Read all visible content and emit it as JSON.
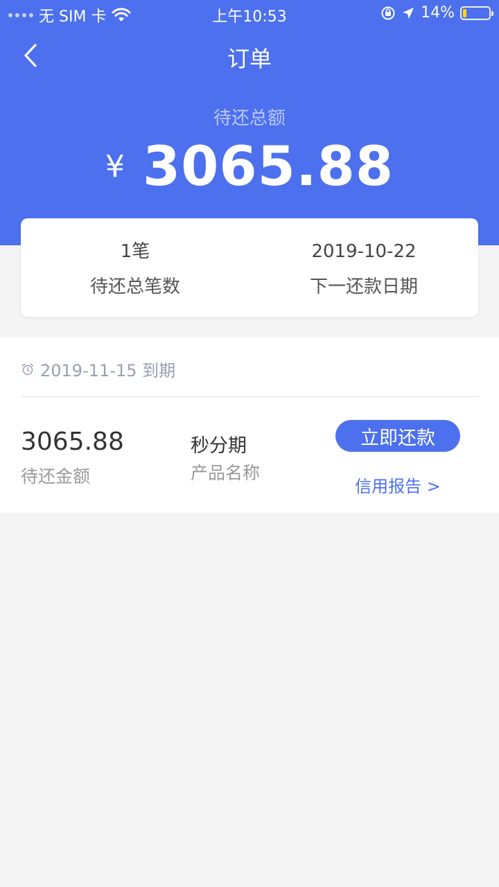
{
  "status_bar": {
    "carrier": "无 SIM 卡",
    "time": "上午10:53",
    "battery": "14%",
    "battery_level": 0.14,
    "icons": [
      "signal-dots-icon",
      "wifi-icon",
      "orientation-lock-icon",
      "location-icon",
      "battery-icon"
    ]
  },
  "nav": {
    "title": "订单",
    "back_icon": "chevron-left-icon"
  },
  "total": {
    "label": "待还总额",
    "currency": "¥",
    "amount": "3065.88"
  },
  "summary": {
    "count_value": "1笔",
    "count_label": "待还总笔数",
    "date_value": "2019-10-22",
    "date_label": "下一还款日期"
  },
  "order": {
    "due_icon": "alarm-clock-icon",
    "due_text": "2019-11-15 到期",
    "amount_value": "3065.88",
    "amount_label": "待还金额",
    "product_value": "秒分期",
    "product_label": "产品名称",
    "repay_button": "立即还款",
    "credit_link": "信用报告 >"
  },
  "colors": {
    "primary": "#4c70ee",
    "background": "#f4f4f4"
  }
}
